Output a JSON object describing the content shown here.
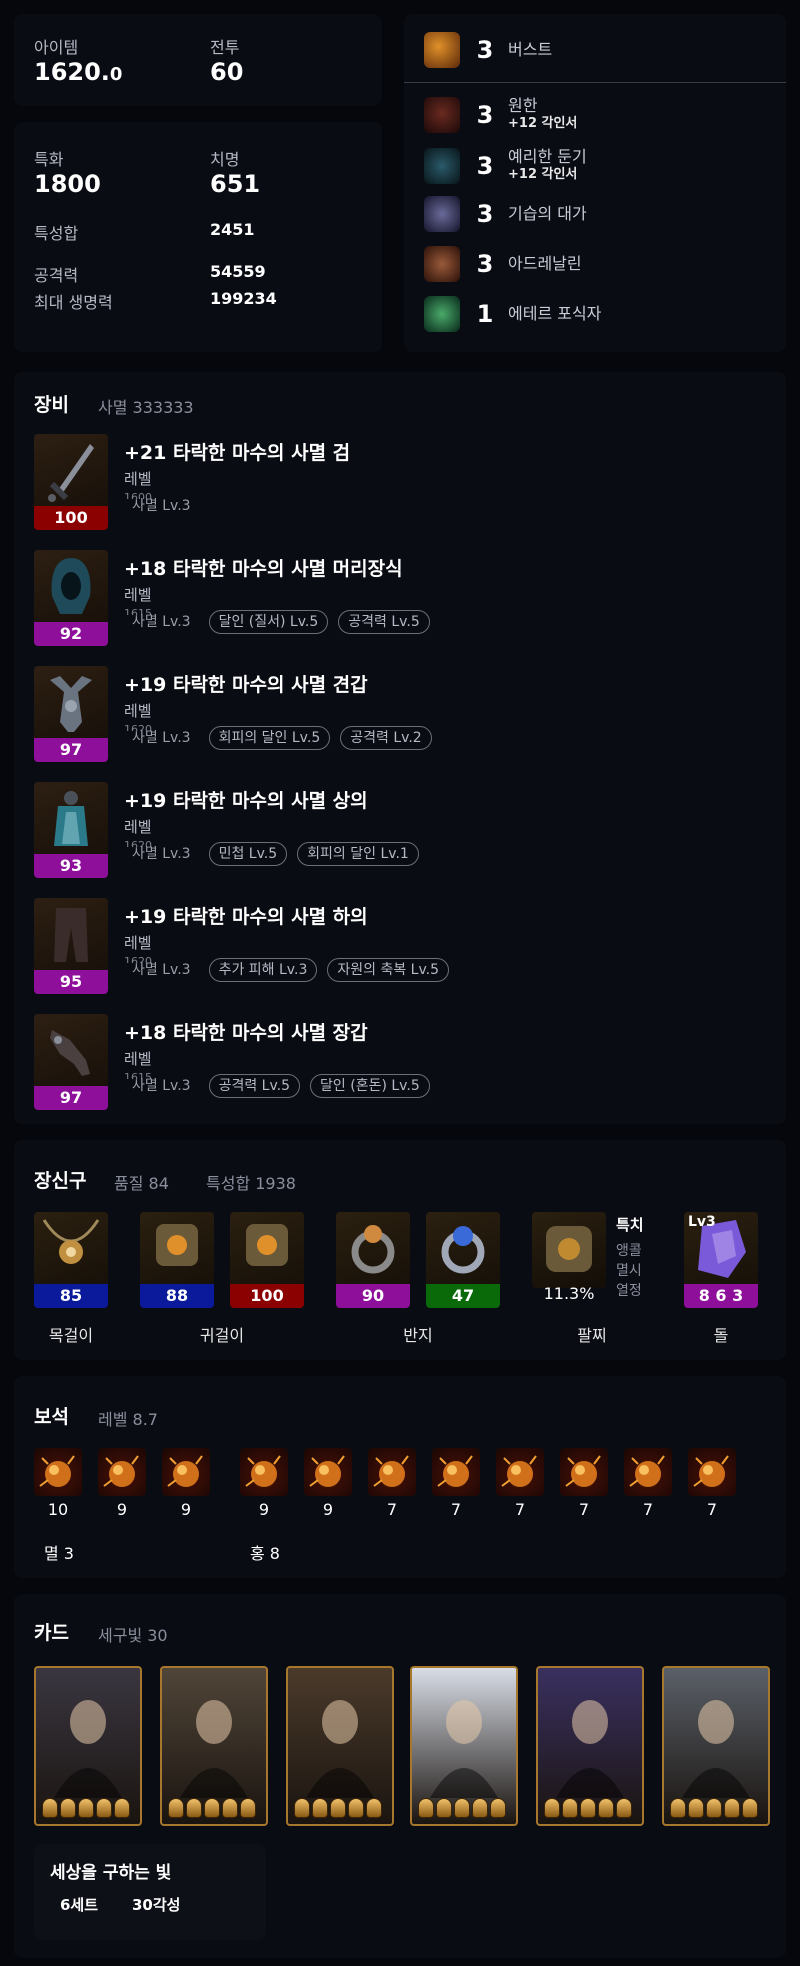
{
  "stats": {
    "item_label": "아이템",
    "item_value_int": "1620.",
    "item_value_dec": "0",
    "combat_label": "전투",
    "combat_value": "60",
    "spec_label": "특화",
    "spec_value": "1800",
    "crit_label": "치명",
    "crit_value": "651",
    "total_label": "특성합",
    "total_value": "2451",
    "atk_label": "공격력",
    "atk_value": "54559",
    "hp_label": "최대 생명력",
    "hp_value": "199234"
  },
  "engravings": {
    "top": {
      "level": "3",
      "name": "버스트",
      "icon": "burst-icon"
    },
    "items": [
      {
        "level": "3",
        "name": "원한",
        "sub": "+12 각인서",
        "icon": "grudge-icon"
      },
      {
        "level": "3",
        "name": "예리한 둔기",
        "sub": "+12 각인서",
        "icon": "keen-blunt-icon"
      },
      {
        "level": "3",
        "name": "기습의 대가",
        "sub": "",
        "icon": "ambush-icon"
      },
      {
        "level": "3",
        "name": "아드레날린",
        "sub": "",
        "icon": "adrenaline-icon"
      },
      {
        "level": "1",
        "name": "에테르 포식자",
        "sub": "",
        "icon": "ether-icon"
      }
    ]
  },
  "equipment": {
    "title": "장비",
    "subtitle": "사멸 333333",
    "items": [
      {
        "name": "+21 타락한 마수의 사멸 검",
        "quality": "100",
        "level_label": "레벨",
        "ghost": "1600",
        "tag0": "사멸 Lv.3",
        "tags": [],
        "color": "#8b0000",
        "icon": "sword-icon"
      },
      {
        "name": "+18 타락한 마수의 사멸 머리장식",
        "quality": "92",
        "level_label": "레벨",
        "ghost": "1615",
        "tag0": "사멸 Lv.3",
        "tags": [
          "달인 (질서) Lv.5",
          "공격력 Lv.5"
        ],
        "color": "#8e0f9a",
        "icon": "helmet-icon"
      },
      {
        "name": "+19 타락한 마수의 사멸 견갑",
        "quality": "97",
        "level_label": "레벨",
        "ghost": "1620",
        "tag0": "사멸 Lv.3",
        "tags": [
          "회피의 달인 Lv.5",
          "공격력 Lv.2"
        ],
        "color": "#8e0f9a",
        "icon": "shoulder-icon"
      },
      {
        "name": "+19 타락한 마수의 사멸 상의",
        "quality": "93",
        "level_label": "레벨",
        "ghost": "1620",
        "tag0": "사멸 Lv.3",
        "tags": [
          "민첩 Lv.5",
          "회피의 달인 Lv.1"
        ],
        "color": "#8e0f9a",
        "icon": "chest-icon"
      },
      {
        "name": "+19 타락한 마수의 사멸 하의",
        "quality": "95",
        "level_label": "레벨",
        "ghost": "1620",
        "tag0": "사멸 Lv.3",
        "tags": [
          "추가 피해 Lv.3",
          "자원의 축복 Lv.5"
        ],
        "color": "#8e0f9a",
        "icon": "pants-icon"
      },
      {
        "name": "+18 타락한 마수의 사멸 장갑",
        "quality": "97",
        "level_label": "레벨",
        "ghost": "1615",
        "tag0": "사멸 Lv.3",
        "tags": [
          "공격력 Lv.5",
          "달인 (혼돈) Lv.5"
        ],
        "color": "#8e0f9a",
        "icon": "gloves-icon"
      }
    ]
  },
  "accessories": {
    "title": "장신구",
    "quality_text": "품질 84",
    "total_text": "특성합 1938",
    "items": [
      {
        "quality": "85",
        "color": "#0a1a9a",
        "icon": "necklace-icon"
      },
      {
        "quality": "88",
        "color": "#0a1a9a",
        "icon": "earring-icon"
      },
      {
        "quality": "100",
        "color": "#8b0000",
        "icon": "earring-icon"
      },
      {
        "quality": "90",
        "color": "#8e0f9a",
        "icon": "ring-icon"
      },
      {
        "quality": "47",
        "color": "#0a6a0a",
        "icon": "ring-blue-icon"
      }
    ],
    "bracelet": {
      "percent": "11.3%",
      "stats": [
        "특치",
        "앵콜",
        "멸시",
        "열정"
      ]
    },
    "stone": {
      "level": "Lv3",
      "values": "8 6 3"
    },
    "labels": [
      "목걸이",
      "귀걸이",
      "반지",
      "팔찌",
      "돌"
    ]
  },
  "gems": {
    "title": "보석",
    "subtitle": "레벨 8.7",
    "levels": [
      "10",
      "9",
      "9",
      "9",
      "9",
      "7",
      "7",
      "7",
      "7",
      "7",
      "7"
    ],
    "group1": "멸 3",
    "group2": "홍 8"
  },
  "cards": {
    "title": "카드",
    "subtitle": "세구빛 30",
    "set_name": "세상을 구하는 빛",
    "set_count": "6세트",
    "awaken": "30각성",
    "colors": [
      "#3a3640",
      "#504538",
      "#4a3a2a",
      "#d8dde6",
      "#3a3060",
      "#5a6068"
    ]
  }
}
